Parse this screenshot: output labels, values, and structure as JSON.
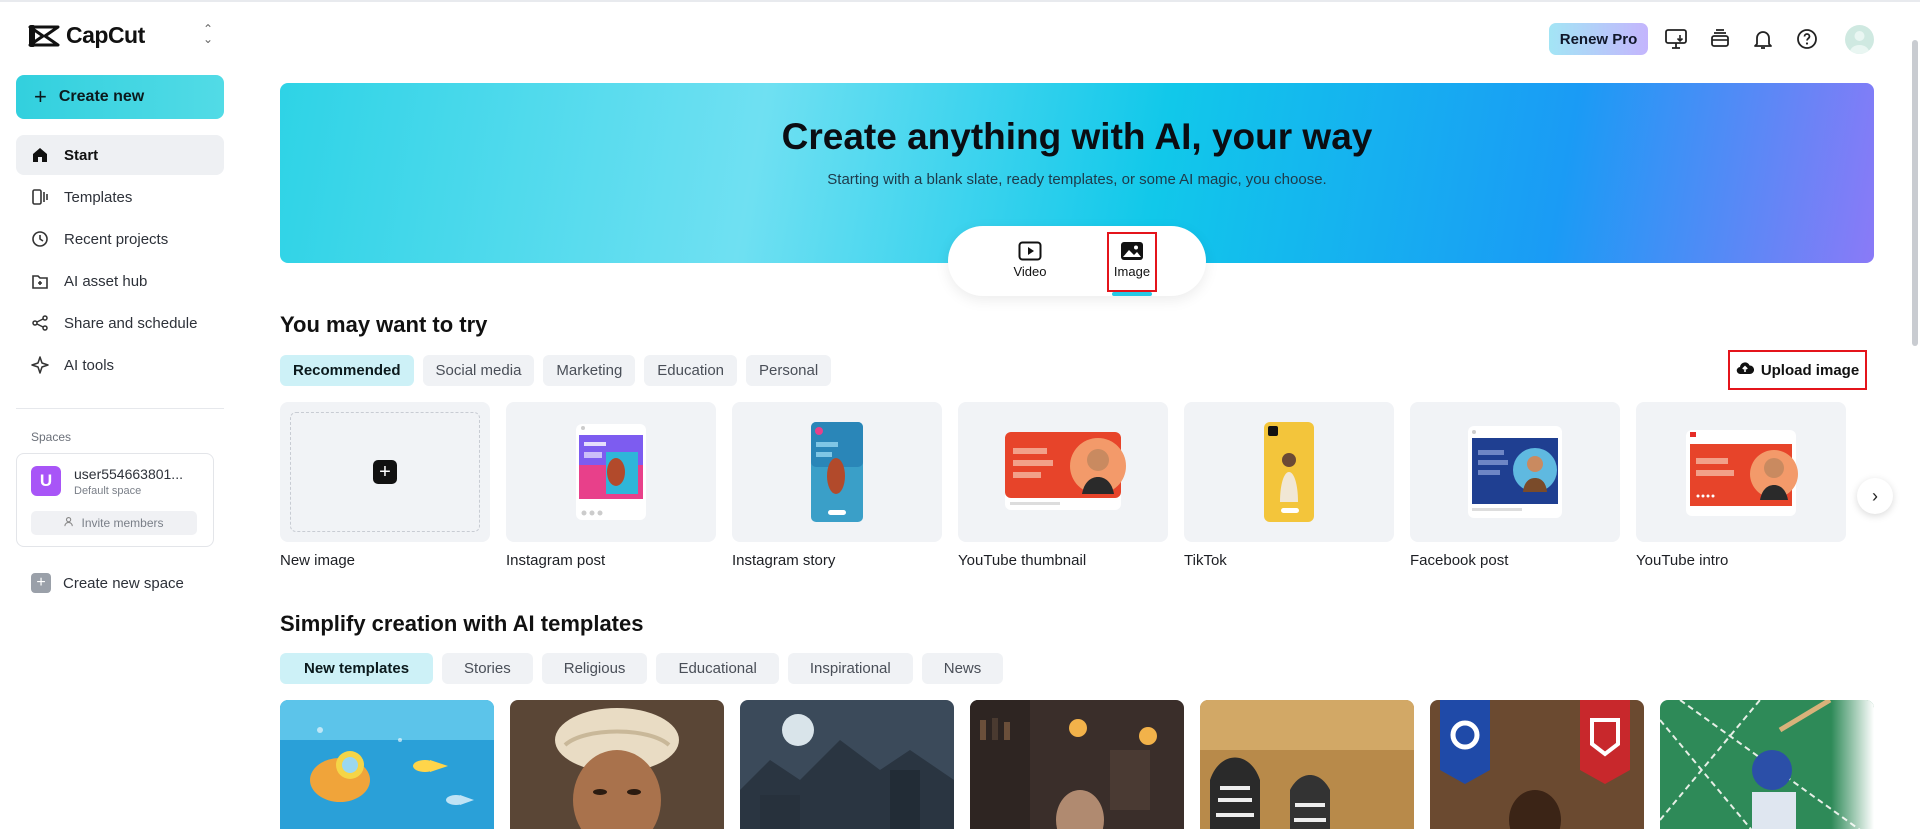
{
  "app": {
    "name": "CapCut"
  },
  "sidebar": {
    "create_label": "Create new",
    "items": [
      {
        "label": "Start",
        "icon": "home-icon"
      },
      {
        "label": "Templates",
        "icon": "templates-icon"
      },
      {
        "label": "Recent projects",
        "icon": "clock-icon"
      },
      {
        "label": "AI asset hub",
        "icon": "asset-hub-icon"
      },
      {
        "label": "Share and schedule",
        "icon": "share-icon"
      },
      {
        "label": "AI tools",
        "icon": "sparkle-icon"
      }
    ],
    "spaces_title": "Spaces",
    "space": {
      "avatar_letter": "U",
      "name": "user554663801...",
      "subtitle": "Default space",
      "invite_label": "Invite members"
    },
    "create_space_label": "Create new space"
  },
  "header": {
    "renew_label": "Renew Pro"
  },
  "hero": {
    "title": "Create anything with AI, your way",
    "subtitle": "Starting with a blank slate, ready templates, or some AI magic, you choose.",
    "modes": [
      {
        "label": "Video"
      },
      {
        "label": "Image"
      }
    ],
    "selected_mode": "Image"
  },
  "try_section": {
    "title": "You may want to try",
    "chips": [
      "Recommended",
      "Social media",
      "Marketing",
      "Education",
      "Personal"
    ],
    "upload_label": "Upload image",
    "cards": [
      "New image",
      "Instagram post",
      "Instagram story",
      "YouTube thumbnail",
      "TikTok",
      "Facebook post",
      "YouTube intro"
    ]
  },
  "templates_section": {
    "title": "Simplify creation with AI templates",
    "chips": [
      "New templates",
      "Stories",
      "Religious",
      "Educational",
      "Inspirational",
      "News"
    ]
  },
  "colors": {
    "accent": "#2ed3e6",
    "highlight_box": "#e4141b"
  }
}
